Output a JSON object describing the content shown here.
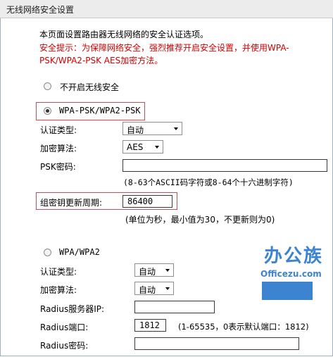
{
  "title": "无线网络安全设置",
  "intro": "本页面设置路由器无线网络的安全认证选项。",
  "tip_line1": "安全提示：为保障网络安全，强烈推荐开启安全设置，并使用WPA-",
  "tip_line2": "PSK/WPA2-PSK AES加密方法。",
  "no_security_label": "不开启无线安全",
  "wpa_psk": {
    "label": "WPA-PSK/WPA2-PSK",
    "auth_type_label": "认证类型:",
    "auth_type_value": "自动",
    "encryption_label": "加密算法:",
    "encryption_value": "AES",
    "psk_label": "PSK密码:",
    "psk_value": "",
    "psk_hint": "(8-63个ASCII码字符或8-64个十六进制字符)",
    "group_key_label": "组密钥更新周期:",
    "group_key_value": "86400",
    "group_key_hint": "(单位为秒，最小值为30，不更新则为0)"
  },
  "wpa": {
    "label": "WPA/WPA2",
    "auth_type_label": "认证类型:",
    "auth_type_value": "自动",
    "encryption_label": "加密算法:",
    "encryption_value": "自动",
    "radius_ip_label": "Radius服务器IP:",
    "radius_ip_value": "",
    "radius_port_label": "Radius端口:",
    "radius_port_value": "1812",
    "radius_port_hint": "(1-65535，0表示默认端口：1812)",
    "radius_password_label": "Radius密码:",
    "radius_password_value": ""
  },
  "watermark": {
    "top": "办公族",
    "mid": "Officezu.com",
    "bottom": "电脑入门"
  }
}
